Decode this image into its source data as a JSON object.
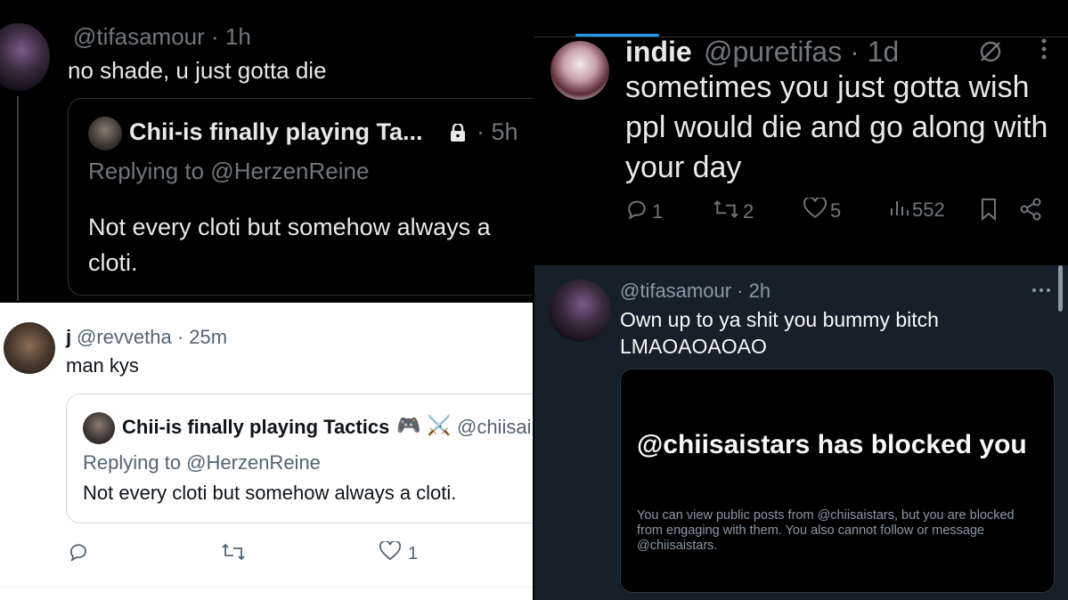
{
  "panel_top_left": {
    "reply": {
      "handle": "@tifasamour",
      "time": "1h",
      "text": "no shade, u just gotta die"
    },
    "quote": {
      "name": "Chii-is finally playing Ta...",
      "lock_icon": "lock-icon",
      "time": "5h",
      "replying_to": "Replying to @HerzenReine",
      "text": "Not every cloti but somehow always a cloti."
    }
  },
  "panel_bottom_left": {
    "reply": {
      "name": "j",
      "handle": "@revvetha",
      "time": "25m",
      "text": "man kys"
    },
    "quote": {
      "name": "Chii-is finally playing Tactics",
      "emoji_1": "🎮",
      "emoji_2": "⚔️",
      "handle": "@chiisai",
      "replying_to": "Replying to @HerzenReine",
      "text": "Not every cloti but somehow always a cloti."
    },
    "actions": {
      "reply_icon": "reply-icon",
      "retweet_icon": "retweet-icon",
      "like_icon": "heart-icon",
      "like_count": "1"
    }
  },
  "panel_top_right": {
    "tweet": {
      "name": "indie",
      "handle": "@puretifas",
      "time": "1d",
      "text": "sometimes you just gotta wish ppl would die and go along with your day"
    },
    "actions": {
      "reply_count": "1",
      "retweet_count": "2",
      "like_count": "5",
      "view_count": "552"
    },
    "colors": {
      "accent": "#1d9bf0"
    }
  },
  "panel_bottom_right": {
    "tweet": {
      "handle": "@tifasamour",
      "time": "2h",
      "text_line1": "Own up to ya shit you bummy bitch",
      "text_line2": "LMAOAOAOAO"
    },
    "blocked": {
      "title": "@chiisaistars has blocked you",
      "body": "You can view public posts from @chiisaistars, but you are blocked from engaging with them. You also cannot follow or message @chiisaistars."
    }
  }
}
